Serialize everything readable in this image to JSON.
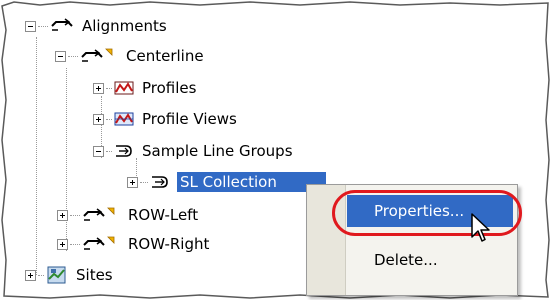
{
  "tree": {
    "items": [
      {
        "label": "Alignments",
        "expanded": true
      },
      {
        "label": "Centerline",
        "expanded": true
      },
      {
        "label": "Profiles",
        "expanded": false
      },
      {
        "label": "Profile Views",
        "expanded": false
      },
      {
        "label": "Sample Line Groups",
        "expanded": true
      },
      {
        "label": "SL Collection",
        "expanded": false,
        "selected": true
      },
      {
        "label": "ROW-Left",
        "expanded": false
      },
      {
        "label": "ROW-Right",
        "expanded": false
      },
      {
        "label": "Sites",
        "expanded": false
      }
    ]
  },
  "context_menu": {
    "items": [
      {
        "label": "Properties...",
        "highlighted": true
      },
      {
        "label": "Delete..."
      }
    ]
  },
  "colors": {
    "selection": "#316ac5",
    "callout": "#e0191e"
  }
}
